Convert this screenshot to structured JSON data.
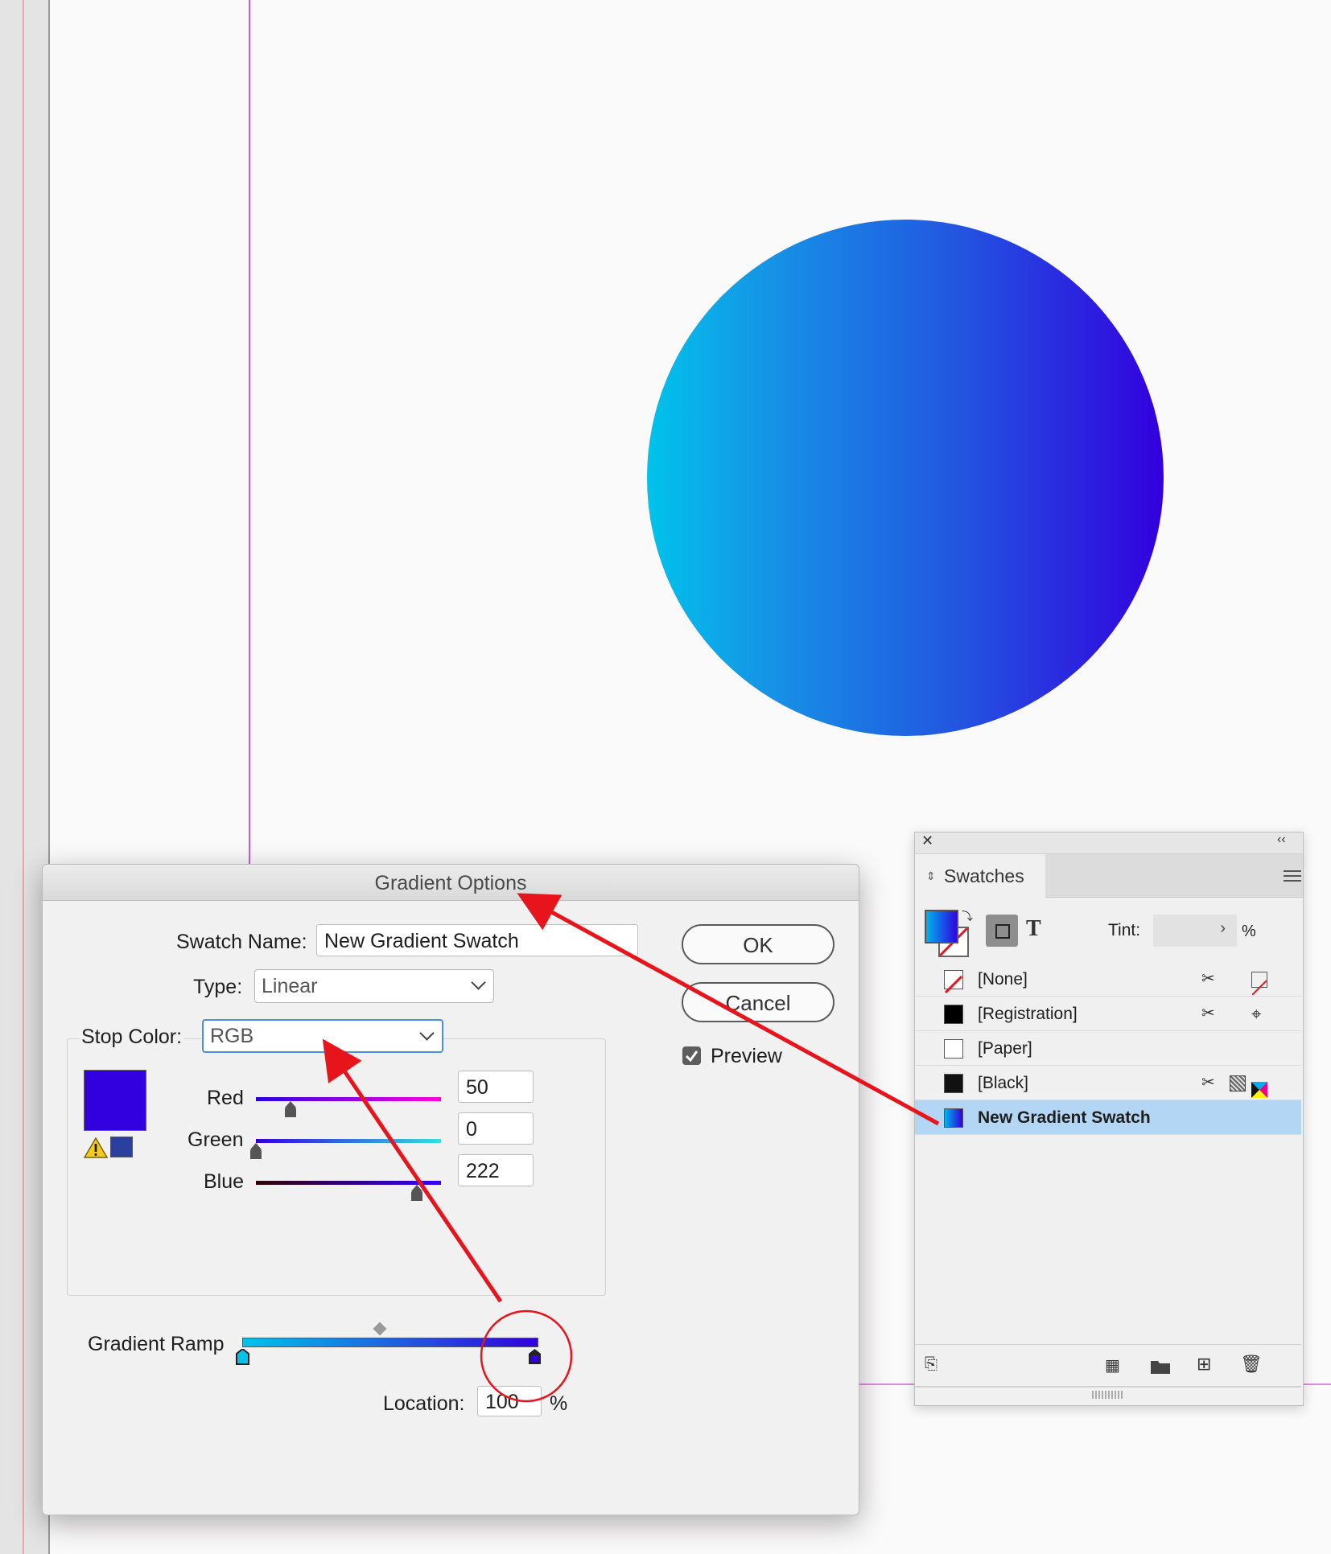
{
  "dialog": {
    "title": "Gradient Options",
    "swatch_name_label": "Swatch Name:",
    "swatch_name_value": "New Gradient Swatch",
    "type_label": "Type:",
    "type_value": "Linear",
    "stop_color_label": "Stop Color:",
    "stop_color_value": "RGB",
    "channels": [
      {
        "label": "Red",
        "value": "50"
      },
      {
        "label": "Green",
        "value": "0"
      },
      {
        "label": "Blue",
        "value": "222"
      }
    ],
    "ok_label": "OK",
    "cancel_label": "Cancel",
    "preview_label": "Preview",
    "preview_checked": true,
    "gradient_ramp_label": "Gradient Ramp",
    "location_label": "Location:",
    "location_value": "100",
    "location_unit": "%",
    "stop_color_hex": "#3200de",
    "ramp_start_hex": "#00c3eb",
    "ramp_end_hex": "#3200de"
  },
  "swatches_panel": {
    "tab_label": "Swatches",
    "tint_label": "Tint:",
    "tint_unit": "%",
    "text_mode_glyph": "T",
    "items": [
      {
        "name": "[None]",
        "selected": false
      },
      {
        "name": "[Registration]",
        "selected": false
      },
      {
        "name": "[Paper]",
        "selected": false
      },
      {
        "name": "[Black]",
        "selected": false
      },
      {
        "name": "New Gradient Swatch",
        "selected": true
      }
    ]
  },
  "colors": {
    "annotation_red": "#e8141b",
    "selection_blue": "#b3d6f5",
    "focus_ring": "#4a8fe0"
  },
  "icons": [
    "close-icon",
    "collapse-icon",
    "panel-menu-icon",
    "swap-icon",
    "not-editable-icon",
    "registration-icon",
    "process-color-icon",
    "warning-icon",
    "place-swatch-icon",
    "swatch-views-icon",
    "folder-icon",
    "new-swatch-icon",
    "trash-icon"
  ]
}
